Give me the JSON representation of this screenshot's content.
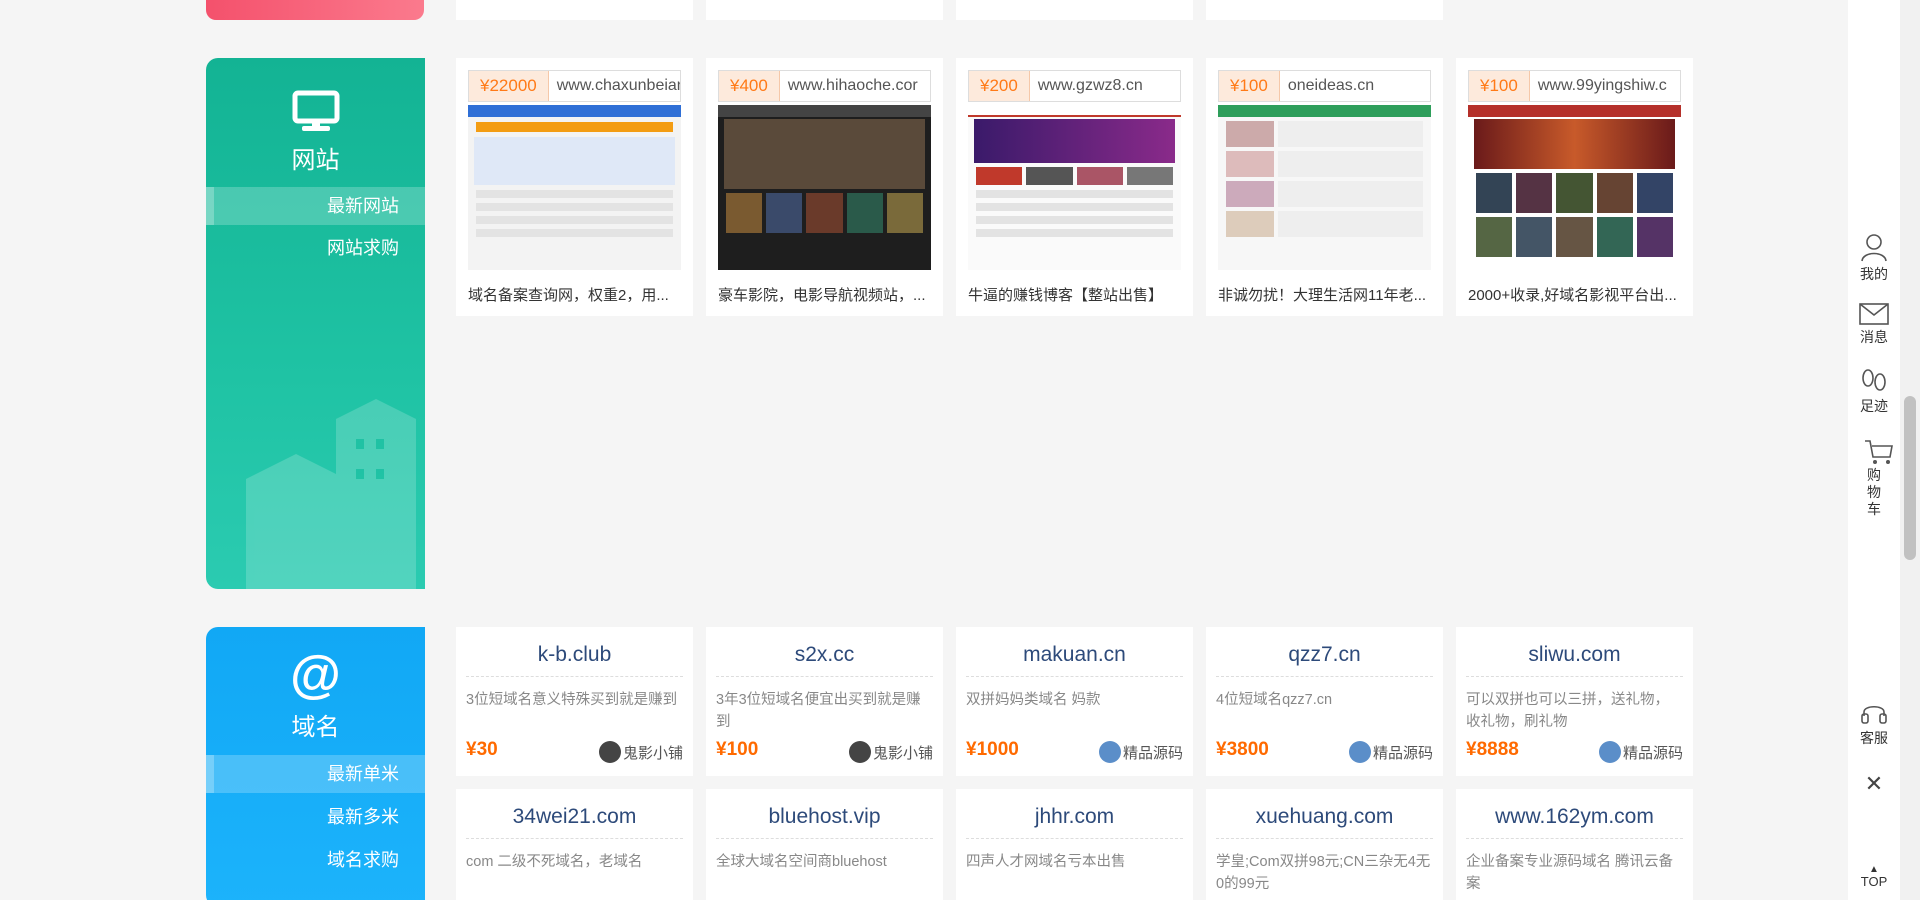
{
  "website_section": {
    "title": "网站",
    "links": [
      "最新网站",
      "网站求购"
    ],
    "cards": [
      {
        "price": "¥22000",
        "url": "www.chaxunbeian",
        "desc": "域名备案查询网，权重2，用...",
        "theme": "#2f6fd6"
      },
      {
        "price": "¥400",
        "url": "www.hihaoche.cor",
        "desc": "豪车影院，电影导航视频站，...",
        "theme": "#333333"
      },
      {
        "price": "¥200",
        "url": "www.gzwz8.cn",
        "desc": "牛逼的赚钱博客【整站出售】",
        "theme": "#c0392b"
      },
      {
        "price": "¥100",
        "url": "oneideas.cn",
        "desc": "非诚勿扰！大理生活网11年老...",
        "theme": "#2e9e5b"
      },
      {
        "price": "¥100",
        "url": "www.99yingshiw.c",
        "desc": "2000+收录,好域名影视平台出...",
        "theme": "#b5302a"
      }
    ]
  },
  "domain_section": {
    "title": "域名",
    "links": [
      "最新单米",
      "最新多米",
      "域名求购"
    ],
    "cards": [
      {
        "name": "k-b.club",
        "desc": "3位短域名意义特殊买到就是赚到",
        "price": "¥30",
        "seller": "鬼影小铺",
        "avatar_color": "#444444"
      },
      {
        "name": "s2x.cc",
        "desc": "3年3位短域名便宜出买到就是赚到",
        "price": "¥100",
        "seller": "鬼影小铺",
        "avatar_color": "#444444"
      },
      {
        "name": "makuan.cn",
        "desc": "双拼妈妈类域名 妈款",
        "price": "¥1000",
        "seller": "精品源码",
        "avatar_color": "#5b8ec9"
      },
      {
        "name": "qzz7.cn",
        "desc": "4位短域名qzz7.cn",
        "price": "¥3800",
        "seller": "精品源码",
        "avatar_color": "#5b8ec9"
      },
      {
        "name": "sliwu.com",
        "desc": "可以双拼也可以三拼，送礼物，收礼物，刷礼物",
        "price": "¥8888",
        "seller": "精品源码",
        "avatar_color": "#5b8ec9"
      },
      {
        "name": "34wei21.com",
        "desc": "com 二级不死域名，老域名"
      },
      {
        "name": "bluehost.vip",
        "desc": "全球大域名空间商bluehost"
      },
      {
        "name": "jhhr.com",
        "desc": "四声人才网域名亏本出售"
      },
      {
        "name": "xuehuang.com",
        "desc": "学皇;Com双拼98元;CN三杂无4无0的99元"
      },
      {
        "name": "www.162ym.com",
        "desc": "企业备案专业源码域名 腾讯云备案"
      }
    ]
  },
  "toolbar": {
    "mine": "我的",
    "messages": "消息",
    "history": "足迹",
    "cart": "购物车",
    "service": "客服",
    "top": "TOP"
  },
  "colors": {
    "website_accent": "#13b394",
    "domain_accent": "#11a8f5",
    "price_orange": "#ff6a00"
  }
}
